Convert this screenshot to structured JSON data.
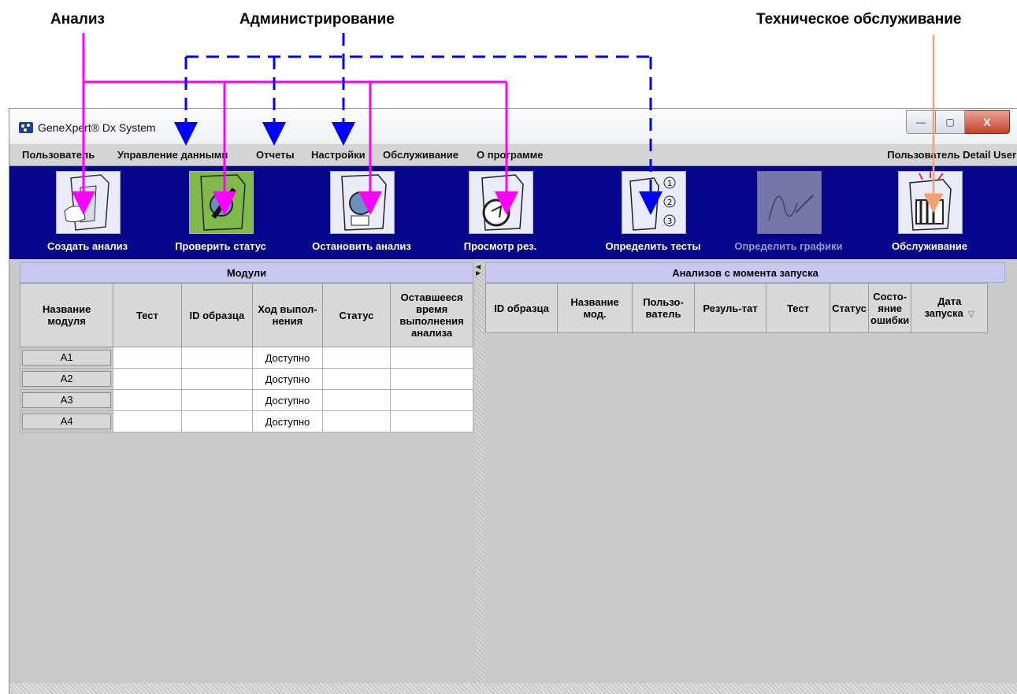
{
  "callouts": {
    "analysis": "Анализ",
    "administration": "Администрирование",
    "maintenance": "Техническое обслуживание"
  },
  "window": {
    "title": "GeneXpert® Dx System",
    "buttons": {
      "minimize": "—",
      "maximize": "▢",
      "close": "X"
    }
  },
  "menu": {
    "items": [
      "Пользователь",
      "Управление данными",
      "Отчеты",
      "Настройки",
      "Обслуживание",
      "О программе"
    ],
    "user_label": "Пользователь Detail User"
  },
  "toolbar": {
    "buttons": [
      {
        "label": "Создать анализ",
        "icon": "create-test-icon",
        "enabled": true
      },
      {
        "label": "Проверить статус",
        "icon": "check-status-icon",
        "enabled": true
      },
      {
        "label": "Остановить анализ",
        "icon": "stop-test-icon",
        "enabled": true
      },
      {
        "label": "Просмотр рез.",
        "icon": "view-results-icon",
        "enabled": true
      },
      {
        "label": "Определить тесты",
        "icon": "define-assays-icon",
        "enabled": true
      },
      {
        "label": "Определить графики",
        "icon": "define-graphs-icon",
        "enabled": false
      },
      {
        "label": "Обслуживание",
        "icon": "maintenance-icon",
        "enabled": true
      }
    ]
  },
  "modules_panel": {
    "title": "Модули",
    "columns": [
      "Название модуля",
      "Тест",
      "ID образца",
      "Ход выпол-нения",
      "Статус",
      "Оставшееся время выполнения анализа"
    ],
    "rows": [
      {
        "name": "A1",
        "test": "",
        "sample_id": "",
        "progress": "Доступно",
        "status": "",
        "remaining": ""
      },
      {
        "name": "A2",
        "test": "",
        "sample_id": "",
        "progress": "Доступно",
        "status": "",
        "remaining": ""
      },
      {
        "name": "A3",
        "test": "",
        "sample_id": "",
        "progress": "Доступно",
        "status": "",
        "remaining": ""
      },
      {
        "name": "A4",
        "test": "",
        "sample_id": "",
        "progress": "Доступно",
        "status": "",
        "remaining": ""
      }
    ]
  },
  "tests_panel": {
    "title": "Анализов с момента запуска",
    "columns": [
      "ID образца",
      "Название мод.",
      "Пользо-ватель",
      "Резуль-тат",
      "Тест",
      "Статус",
      "Состо-яние ошибки",
      "Дата запуска"
    ]
  },
  "colors": {
    "toolbar_bg": "#06068c",
    "panel_header": "#c8c8f0",
    "analysis_arrow": "#ff00ff",
    "admin_arrow": "#0000ff",
    "maintenance_arrow": "#f4a070"
  }
}
